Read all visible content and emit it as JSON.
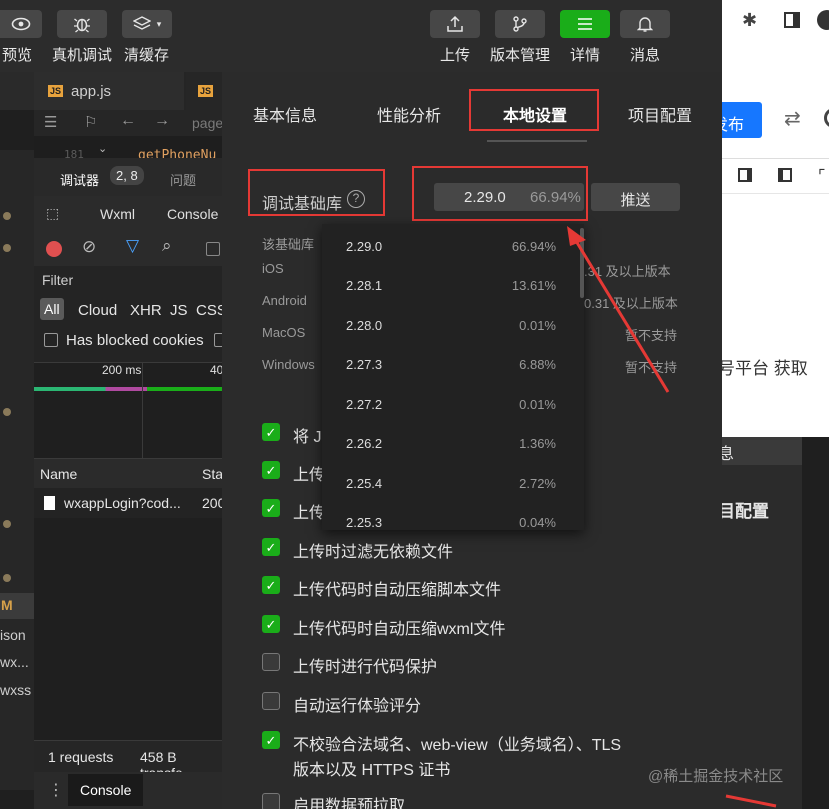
{
  "toolbar": {
    "preview": "预览",
    "debug": "真机调试",
    "clear_cache": "清缓存",
    "upload": "上传",
    "version": "版本管理",
    "details": "详情",
    "messages": "消息"
  },
  "file_tabs": {
    "app_js": "app.js",
    "js_badge": "JS",
    "page_trunc": "page",
    "code_line_no": "181",
    "code_fn": "getPhoneNu"
  },
  "devtools": {
    "debugger_tab": "调试器",
    "badge": "2, 8",
    "issues_tab": "问题",
    "wxml_tab": "Wxml",
    "console_tab": "Console",
    "filter_label": "Filter",
    "filter_all": "All",
    "filter_types": [
      "Cloud",
      "XHR",
      "JS",
      "CSS"
    ],
    "blocked_cookies": "Has blocked cookies",
    "timeline_200": "200 ms",
    "timeline_40": "40",
    "col_name": "Name",
    "col_status": "Sta",
    "request_name": "wxappLogin?cod...",
    "request_status": "200",
    "requests_count": "1 requests",
    "transfer": "458 B transfe",
    "console_drawer": "Console"
  },
  "gutter_labels": {
    "m": "M",
    "json": "ison",
    "wx": "wx...",
    "wxss": "wxss"
  },
  "panel": {
    "tabs": [
      "基本信息",
      "性能分析",
      "本地设置",
      "项目配置"
    ],
    "active_tab": "本地设置",
    "lib_label": "调试基础库",
    "lib_version": "2.29.0",
    "lib_percent": "66.94%",
    "push_button": "推送",
    "info_label": "该基础库",
    "platforms": [
      {
        "name": "iOS",
        "support": ".31 及以上版本"
      },
      {
        "name": "Android",
        "support": "0.31 及以上版本"
      },
      {
        "name": "MacOS",
        "support": "暂不支持"
      },
      {
        "name": "Windows",
        "support": "暂不支持"
      }
    ]
  },
  "dropdown": [
    {
      "version": "2.29.0",
      "percent": "66.94%"
    },
    {
      "version": "2.28.1",
      "percent": "13.61%"
    },
    {
      "version": "2.28.0",
      "percent": "0.01%"
    },
    {
      "version": "2.27.3",
      "percent": "6.88%"
    },
    {
      "version": "2.27.2",
      "percent": "0.01%"
    },
    {
      "version": "2.26.2",
      "percent": "1.36%"
    },
    {
      "version": "2.25.4",
      "percent": "2.72%"
    },
    {
      "version": "2.25.3",
      "percent": "0.04%"
    }
  ],
  "options": [
    {
      "label": "将 JS",
      "checked": true
    },
    {
      "label": "上传",
      "checked": true
    },
    {
      "label": "上传",
      "checked": true
    },
    {
      "label": "上传时过滤无依赖文件",
      "checked": true
    },
    {
      "label": "上传代码时自动压缩脚本文件",
      "checked": true
    },
    {
      "label": "上传代码时自动压缩wxml文件",
      "checked": true
    },
    {
      "label": "上传时进行代码保护",
      "checked": false
    },
    {
      "label": "自动运行体验评分",
      "checked": false
    },
    {
      "label": "不校验合法域名、web-view（业务域名）、TLS",
      "label2": "版本以及 HTTPS 证书",
      "checked": true
    },
    {
      "label": "启用数据预拉取",
      "checked": false
    }
  ],
  "browser": {
    "publish": "发布",
    "platform_text": "号平台 获取"
  },
  "right_dark": {
    "info": "息",
    "config": "目配置"
  },
  "watermark": "@稀土掘金技术社区",
  "colors": {
    "accent_green": "#1aad19",
    "highlight_red": "#e53935",
    "blue_button": "#1677ff"
  },
  "icons": [
    "eye-icon",
    "bug-icon",
    "layers-icon",
    "upload-icon",
    "branch-icon",
    "menu-icon",
    "bell-icon",
    "puzzle-icon",
    "sidebar-icon",
    "swap-icon"
  ]
}
